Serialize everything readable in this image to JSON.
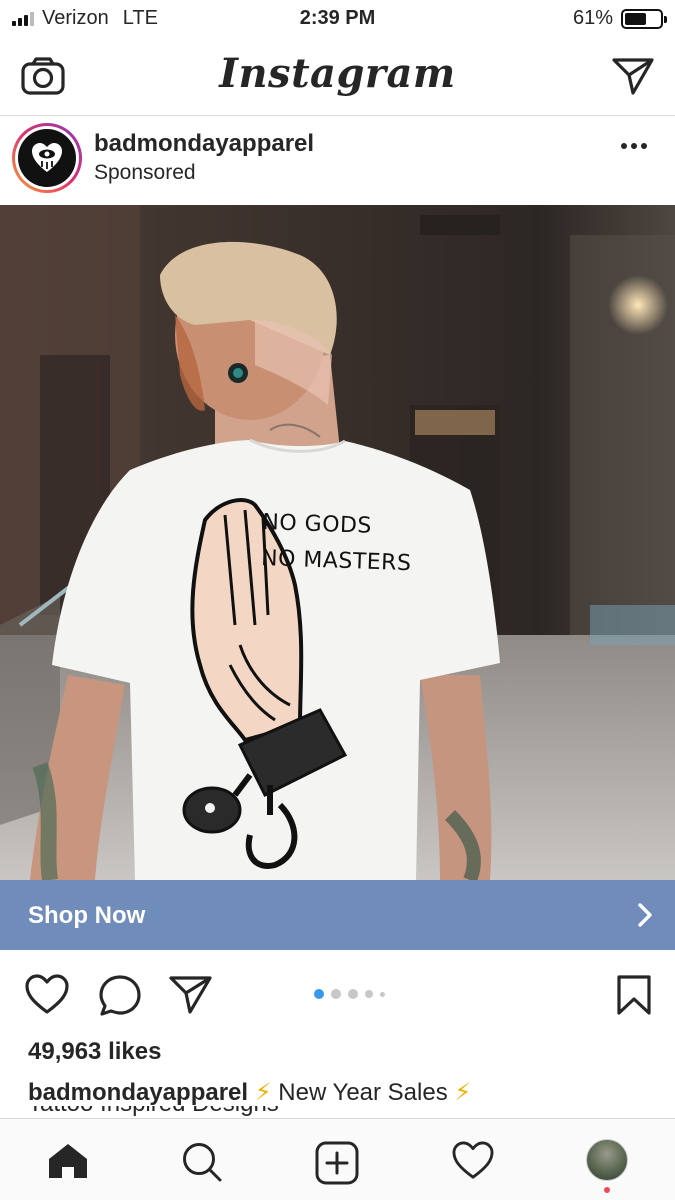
{
  "status_bar": {
    "carrier": "Verizon",
    "network": "LTE",
    "time": "2:39 PM",
    "battery_percent": "61%",
    "battery_level": 0.61
  },
  "nav": {
    "title": "Instagram",
    "left_icon": "camera-icon",
    "right_icon": "direct-message-icon"
  },
  "post": {
    "username": "badmondayapparel",
    "sponsored_label": "Sponsored",
    "image_text_line1": "NO GODS",
    "image_text_line2": "NO MASTERS",
    "cta_label": "Shop Now",
    "likes": "49,963 likes",
    "caption_user": "badmondayapparel",
    "caption_emoji": "⚡",
    "caption_text": "New Year Sales",
    "caption_next_line": "Tattoo Inspired Designs",
    "carousel": {
      "count": 5,
      "active_index": 0
    }
  },
  "colors": {
    "accent_blue": "#3897f0",
    "cta_background": "#6f8cbb",
    "notification_red": "#ed4956"
  },
  "tabbar": {
    "items": [
      "home-icon",
      "search-icon",
      "add-post-icon",
      "activity-heart-icon",
      "profile-avatar"
    ]
  }
}
